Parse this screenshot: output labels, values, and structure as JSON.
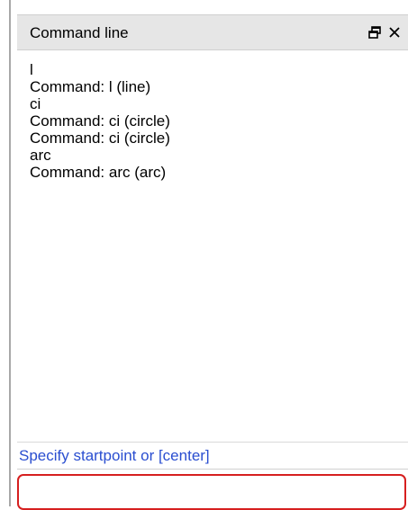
{
  "panel": {
    "title": "Command line",
    "float_icon": "float-window-icon",
    "close_icon": "close-icon"
  },
  "log": {
    "lines": [
      "l",
      "Command: l (line)",
      "ci",
      "Command: ci (circle)",
      "Command: ci (circle)",
      "arc",
      "Command: arc (arc)"
    ]
  },
  "prompt": {
    "text": "Specify startpoint or [center]"
  },
  "input": {
    "value": "",
    "placeholder": ""
  },
  "colors": {
    "prompt_text": "#2a4ed0",
    "input_border": "#d61f1f",
    "title_bar": "#e6e6e6"
  }
}
